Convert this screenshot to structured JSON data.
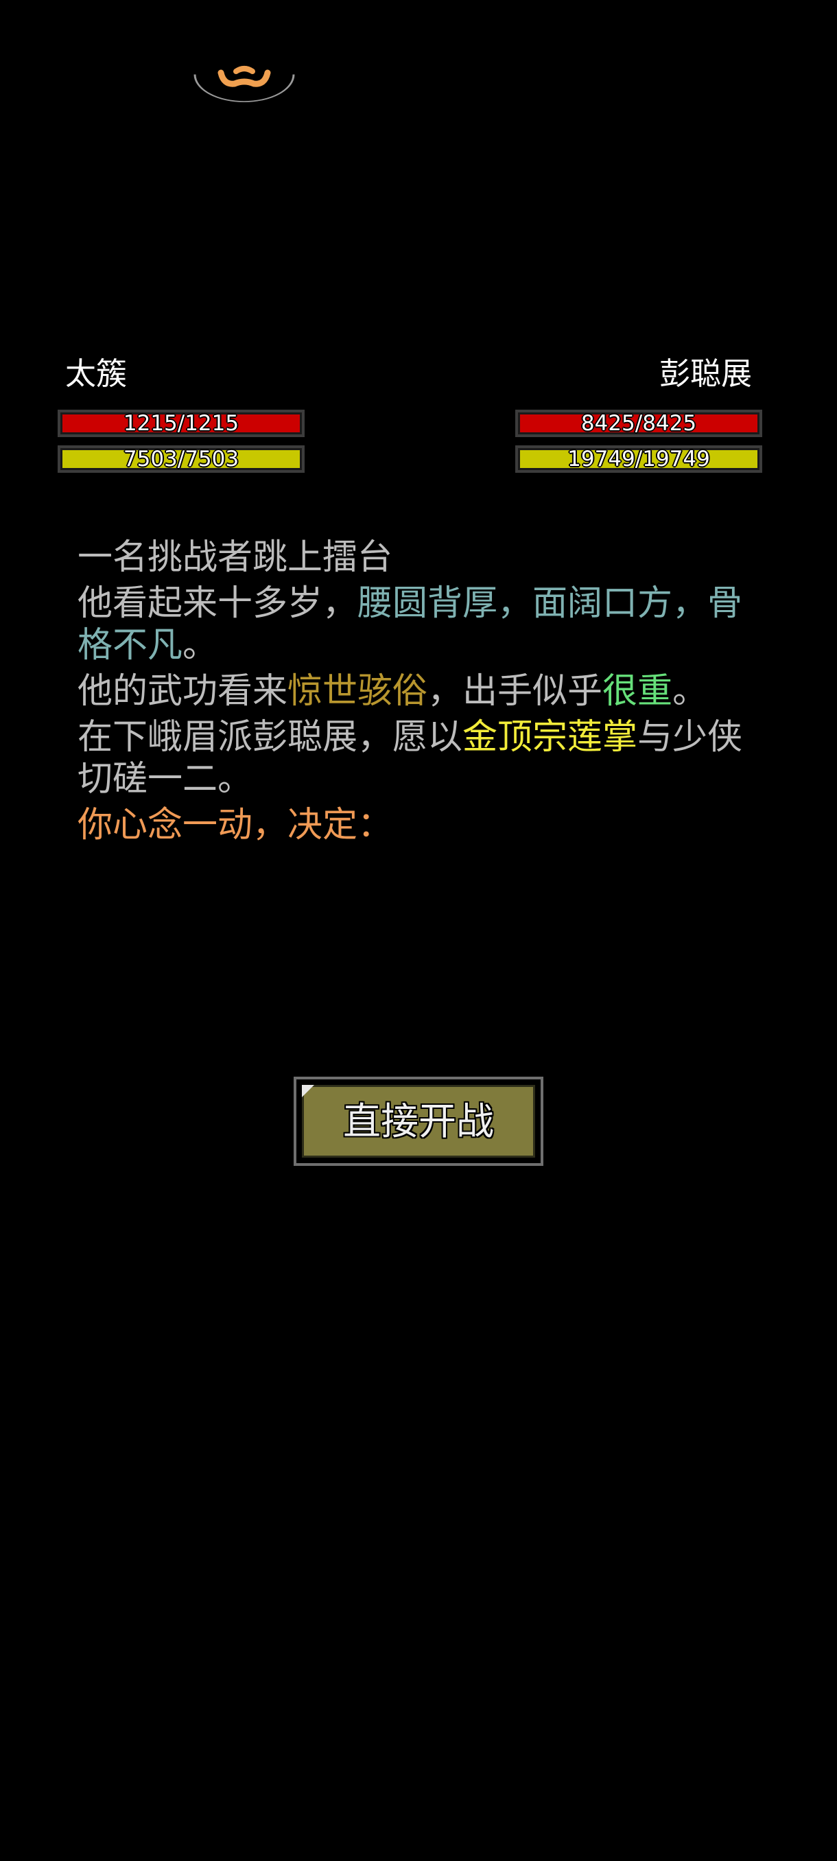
{
  "player": {
    "name": "太簇",
    "hp": {
      "text": "1215/1215",
      "current": 1215,
      "max": 1215
    },
    "mp": {
      "text": "7503/7503",
      "current": 7503,
      "max": 7503
    }
  },
  "enemy": {
    "name": "彭聪展",
    "hp": {
      "text": "8425/8425",
      "current": 8425,
      "max": 8425
    },
    "mp": {
      "text": "19749/19749",
      "current": 19749,
      "max": 19749
    }
  },
  "story": {
    "line1": "一名挑战者跳上擂台",
    "line2": {
      "a": "他看起来十多岁，",
      "b": "腰圆背厚，面阔口方，骨格不凡",
      "c": "。"
    },
    "line3": {
      "a": "他的武功看来",
      "b": "惊世骇俗",
      "c": "，出手似乎",
      "d": "很重",
      "e": "。"
    },
    "line4": {
      "a": "在下峨眉派彭聪展，愿以",
      "b": "金顶宗莲掌",
      "c": "与少侠切磋一二。"
    },
    "line5": "你心念一动，决定："
  },
  "actions": {
    "start_battle": "直接开战"
  },
  "colors": {
    "hp": "#cc0000",
    "mp": "#c8c800",
    "teal": "#7fb2b2",
    "gold": "#b8962e",
    "green": "#66e07a",
    "yellow": "#f2ec3a",
    "orange": "#f09a55",
    "button": "#807b3c"
  }
}
